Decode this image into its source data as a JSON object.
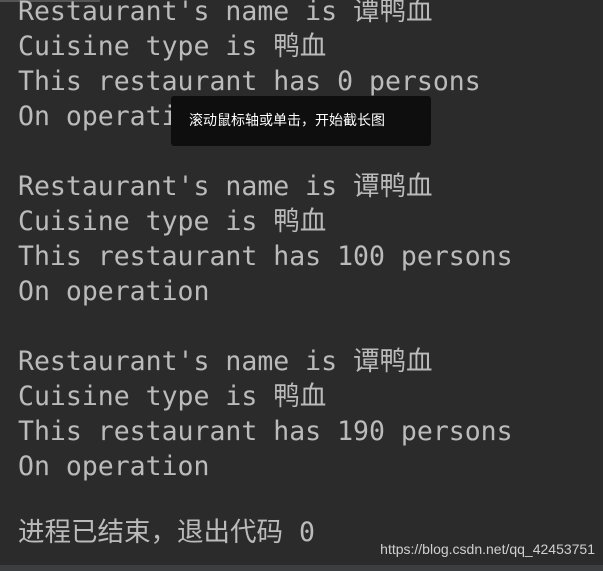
{
  "console": {
    "lines": [
      "Restaurant's name is 谭鸭血",
      "Cuisine type is 鸭血",
      "This restaurant has 0 persons",
      "On operation",
      "",
      "Restaurant's name is 谭鸭血",
      "Cuisine type is 鸭血",
      "This restaurant has 100 persons",
      "On operation",
      "",
      "Restaurant's name is 谭鸭血",
      "Cuisine type is 鸭血",
      "This restaurant has 190 persons",
      "On operation"
    ],
    "exit_message": "进程已结束，退出代码 0"
  },
  "tooltip": "滚动鼠标轴或单击，开始截长图",
  "watermark": "https://blog.csdn.net/qq_42453751"
}
